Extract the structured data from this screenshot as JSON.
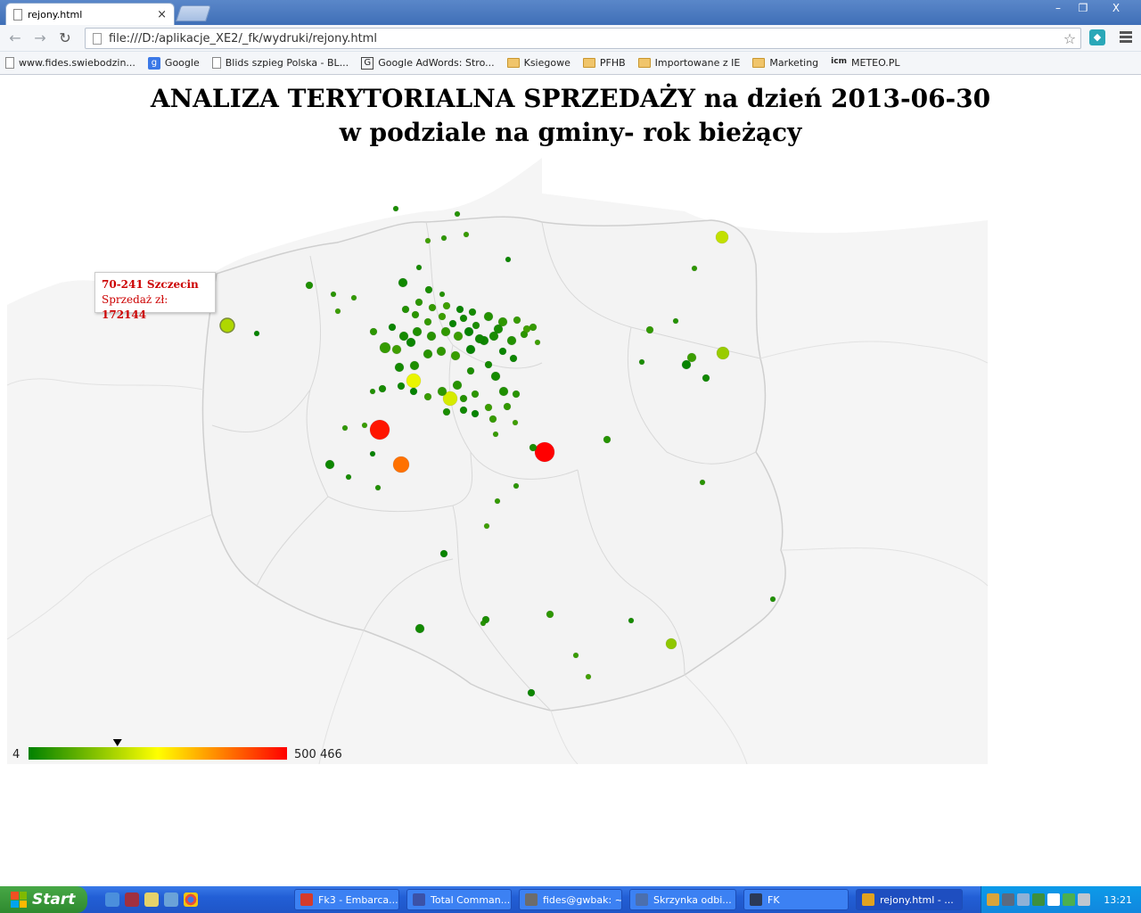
{
  "browser": {
    "tab_title": "rejony.html",
    "tab_close": "×",
    "url": "file:///D:/aplikacje_XE2/_fk/wydruki/rejony.html",
    "back": "←",
    "forward": "→",
    "reload": "↻",
    "star": "☆",
    "window_controls": {
      "minimize": "–",
      "maximize": "❐",
      "close": "X"
    }
  },
  "bookmarks": [
    {
      "label": "www.fides.swiebodzin...",
      "icon": "page-icon"
    },
    {
      "label": "Google",
      "icon": "google-icon"
    },
    {
      "label": "Blids szpieg Polska - BL...",
      "icon": "page-icon"
    },
    {
      "label": "Google AdWords: Stro...",
      "icon": "adwords-icon"
    },
    {
      "label": "Ksiegowe",
      "icon": "folder-icon"
    },
    {
      "label": "PFHB",
      "icon": "folder-icon"
    },
    {
      "label": "Importowane z IE",
      "icon": "folder-icon"
    },
    {
      "label": "Marketing",
      "icon": "folder-icon"
    },
    {
      "label": "METEO.PL",
      "icon": "icm-icon"
    }
  ],
  "page": {
    "title_line1": "ANALIZA TERYTORIALNA SPRZEDAŻY na dzień 2013-06-30",
    "title_line2": "w podziale na gminy- rok bieżący"
  },
  "tooltip": {
    "place": "70-241 Szczecin",
    "label": "Sprzedaż zł:",
    "value": "172144"
  },
  "legend": {
    "min_label": "4",
    "max_label": "500 466",
    "min_value": 4,
    "max_value": 500466,
    "marker_value": 172144,
    "colors": [
      "#008000",
      "#ffff00",
      "#ff0000"
    ]
  },
  "chart_data": {
    "type": "scatter",
    "note_scale": "bubble map of sales by municipality",
    "points": [
      {
        "name": "70-241 Szczecin",
        "value": 172144
      },
      {
        "name": "",
        "value": 480000
      },
      {
        "name": "",
        "value": 500466
      },
      {
        "name": "",
        "value": 390000
      },
      {
        "name": "",
        "value": 230000
      },
      {
        "name": "",
        "value": 210000
      },
      {
        "name": "",
        "value": 190000
      },
      {
        "name": "",
        "value": 150000
      },
      {
        "name": "",
        "value": 140000
      }
    ]
  },
  "taskbar": {
    "start_label": "Start",
    "tasks": [
      {
        "label": "Fk3 - Embarca...",
        "color": "#d53b2c"
      },
      {
        "label": "Total Comman...",
        "color": "#3b52a8"
      },
      {
        "label": "fides@gwbak: ~",
        "color": "#6c6c6c"
      },
      {
        "label": "Skrzynka odbi...",
        "color": "#4b6fae"
      },
      {
        "label": "FK",
        "color": "#2b3a57"
      },
      {
        "label": "rejony.html - ...",
        "color": "#e2a21f"
      }
    ],
    "clock": "13:21"
  }
}
